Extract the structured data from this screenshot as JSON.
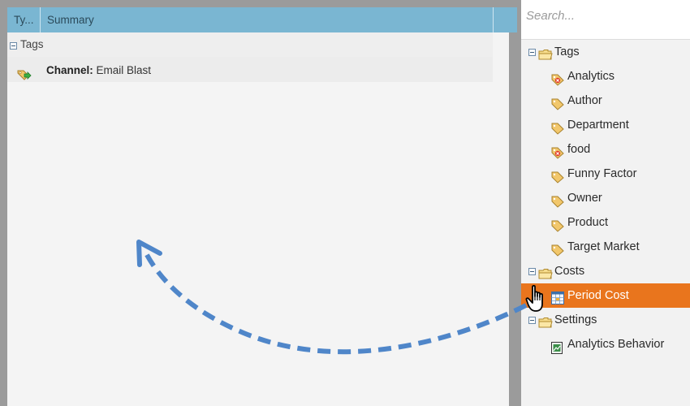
{
  "grid": {
    "columns": [
      "Ty...",
      "Summary"
    ],
    "group_label": "Tags",
    "row": {
      "key": "Channel:",
      "value": "Email Blast"
    }
  },
  "sidebar": {
    "search_placeholder": "Search...",
    "tags_folder": "Tags",
    "tags": [
      "Analytics",
      "Author",
      "Department",
      "food",
      "Funny Factor",
      "Owner",
      "Product",
      "Target Market"
    ],
    "costs_folder": "Costs",
    "costs_items": [
      "Period Cost"
    ],
    "settings_folder": "Settings",
    "settings_items": [
      "Analytics Behavior"
    ]
  },
  "colors": {
    "header": "#7ab6d2",
    "selected": "#e9751d",
    "arrow": "#4f86c9"
  }
}
